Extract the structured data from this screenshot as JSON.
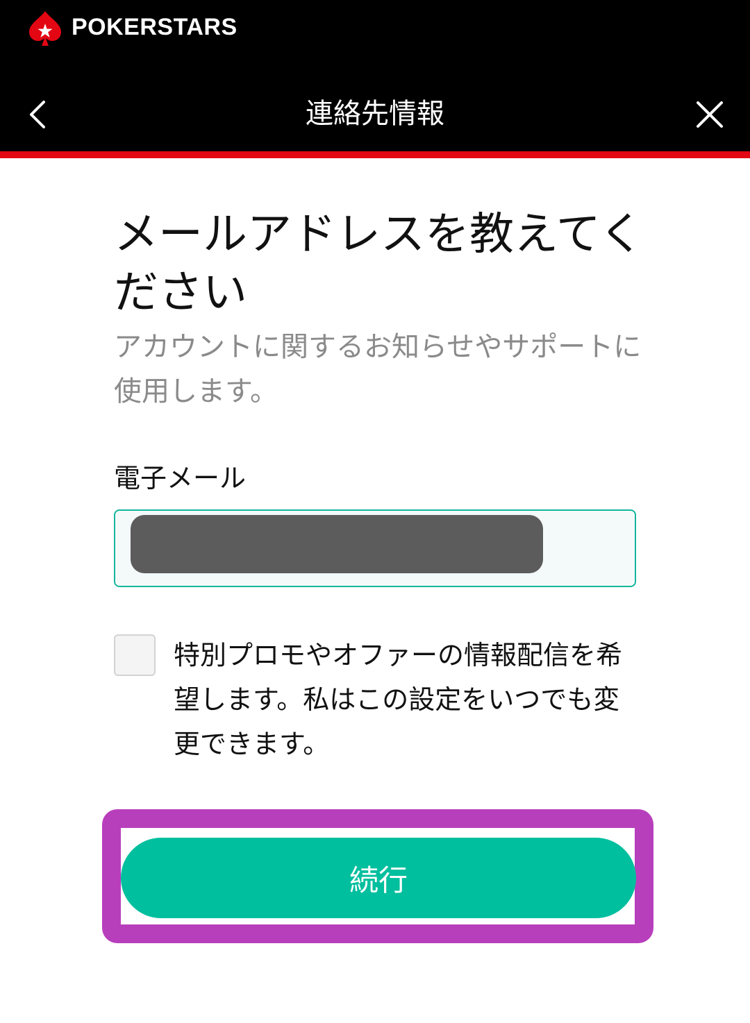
{
  "brand": {
    "name": "POKERSTARS",
    "logo_icon": "star-spade-logo-icon"
  },
  "header": {
    "title": "連絡先情報",
    "back_icon": "chevron-left-icon",
    "close_icon": "close-icon"
  },
  "content": {
    "heading": "メールアドレスを教えてください",
    "subtitle": "アカウントに関するお知らせやサポートに使用します。",
    "email": {
      "label": "電子メール",
      "value": ""
    },
    "consent": {
      "checked": false,
      "label": "特別プロモやオファーの情報配信を希望します。私はこの設定をいつでも変更できます。"
    },
    "continue_label": "続行"
  },
  "colors": {
    "header_bg": "#000000",
    "accent_red": "#e30613",
    "primary_green": "#00bf9e",
    "field_border": "#14b69b",
    "highlight_frame": "#b83fbc"
  }
}
